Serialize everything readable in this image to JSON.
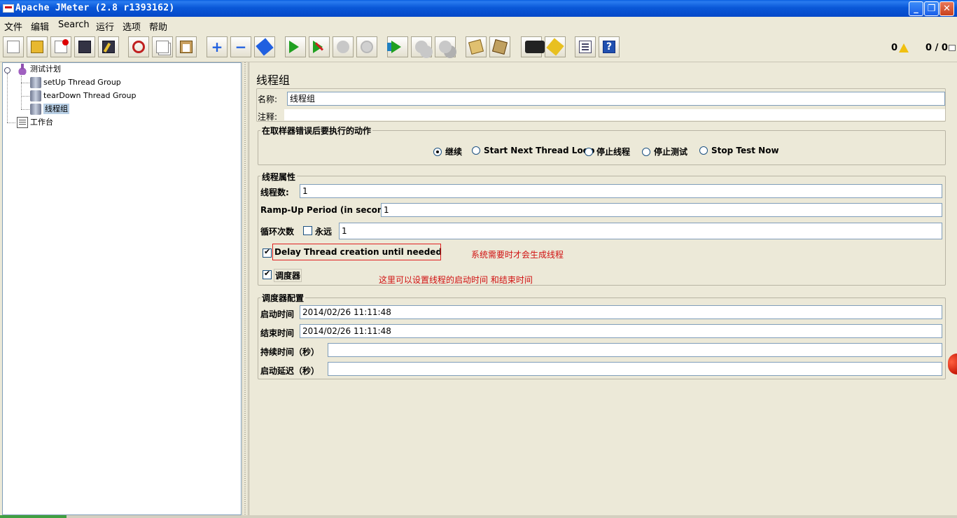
{
  "window": {
    "title": "Apache JMeter (2.8 r1393162)"
  },
  "menu": {
    "items": [
      "文件",
      "编辑",
      "Search",
      "运行",
      "选项",
      "帮助"
    ]
  },
  "toolbar": {
    "icons": [
      "new-icon",
      "open-icon",
      "close-icon",
      "save-icon",
      "save-as-icon",
      "cut-icon",
      "copy-icon",
      "paste-icon",
      "expand-icon",
      "collapse-icon",
      "toggle-icon",
      "start-icon",
      "start-no-timers-icon",
      "stop-icon",
      "shutdown-icon",
      "remote-start-icon",
      "remote-stop-icon",
      "remote-shutdown-icon",
      "clear-icon",
      "clear-all-icon",
      "search-icon",
      "reset-search-icon",
      "function-helper-icon",
      "help-icon"
    ],
    "expand_label": "+",
    "collapse_label": "−",
    "help_label": "?"
  },
  "status": {
    "error_count": "0",
    "threads": "0 / 0"
  },
  "tree": {
    "nodes": [
      "测试计划",
      "setUp Thread Group",
      "tearDown Thread Group",
      "线程组",
      "工作台"
    ],
    "selected": "线程组"
  },
  "panel": {
    "title": "线程组",
    "name_label": "名称:",
    "name_value": "线程组",
    "comment_label": "注释:",
    "comment_value": ""
  },
  "error_action": {
    "title": "在取样器错误后要执行的动作",
    "options": [
      "继续",
      "Start Next Thread Loop",
      "停止线程",
      "停止测试",
      "Stop Test Now"
    ],
    "selected": "继续"
  },
  "thread_props": {
    "title": "线程属性",
    "threads_label": "线程数:",
    "threads_value": "1",
    "rampup_label": "Ramp-Up Period (in seconds):",
    "rampup_value": "1",
    "loop_label": "循环次数",
    "forever_label": "永远",
    "forever_checked": false,
    "loop_value": "1",
    "delay_label": "Delay Thread creation until needed",
    "delay_checked": true,
    "scheduler_label": "调度器",
    "scheduler_checked": true
  },
  "annotations": {
    "delay_note": "系统需要时才会生成线程",
    "scheduler_note": "这里可以设置线程的启动时间  和结束时间",
    "color": "#d01010"
  },
  "scheduler": {
    "title": "调度器配置",
    "start_label": "启动时间",
    "start_value": "2014/02/26 11:11:48",
    "end_label": "结束时间",
    "end_value": "2014/02/26 11:11:48",
    "duration_label": "持续时间（秒）",
    "duration_value": "",
    "delay_label": "启动延迟（秒）",
    "delay_value": ""
  }
}
